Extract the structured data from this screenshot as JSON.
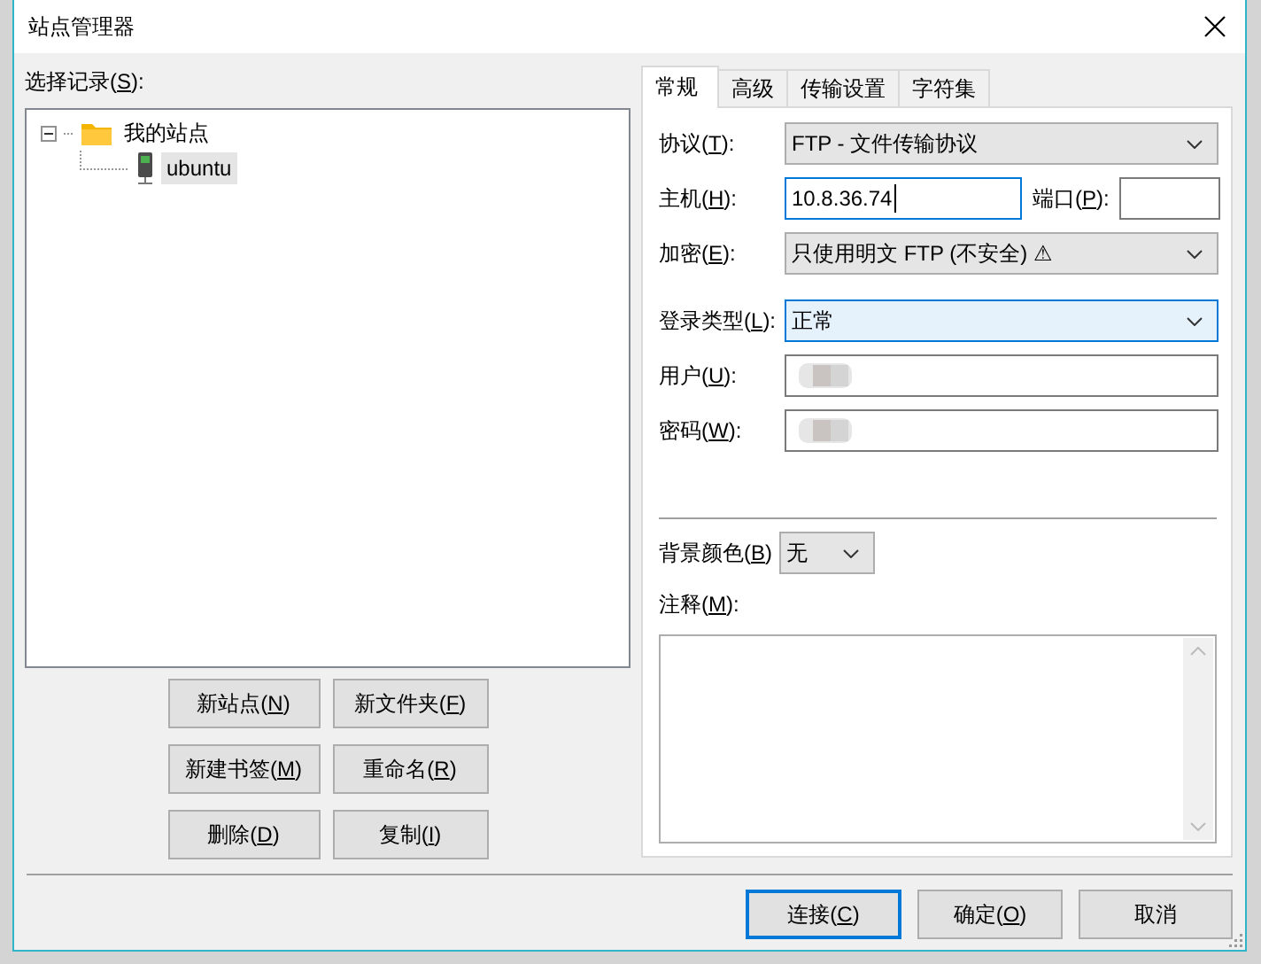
{
  "window": {
    "title": "站点管理器"
  },
  "site_list": {
    "label": [
      "选择记录(",
      "S",
      "):"
    ],
    "tree": [
      {
        "label": "我的站点",
        "kind": "folder",
        "expanded": true,
        "selected": false,
        "children": [
          {
            "label": "ubuntu",
            "kind": "server",
            "selected": true
          }
        ]
      }
    ]
  },
  "site_buttons": [
    {
      "label": [
        "新站点(",
        "N",
        ")"
      ]
    },
    {
      "label": [
        "新文件夹(",
        "F",
        ")"
      ]
    },
    {
      "label": [
        "新建书签(",
        "M",
        ")"
      ]
    },
    {
      "label": [
        "重命名(",
        "R",
        ")"
      ]
    },
    {
      "label": [
        "删除(",
        "D",
        ")"
      ]
    },
    {
      "label": [
        "复制(",
        "I",
        ")"
      ]
    }
  ],
  "tabs": [
    {
      "label": "常规",
      "selected": true
    },
    {
      "label": "高级",
      "selected": false
    },
    {
      "label": "传输设置",
      "selected": false
    },
    {
      "label": "字符集",
      "selected": false
    }
  ],
  "general": {
    "fields": [
      {
        "kind": "dropdown",
        "label": [
          "协议(",
          "T",
          "):"
        ],
        "value": "FTP - 文件传输协议",
        "focused": false
      },
      {
        "kind": "host",
        "label": [
          "主机(",
          "H",
          "):"
        ],
        "value": "10.8.36.74",
        "focused": true,
        "port_label": [
          "端口(",
          "P",
          "):"
        ]
      },
      {
        "kind": "dropdown",
        "label": [
          "加密(",
          "E",
          "):"
        ],
        "value": "只使用明文 FTP (不安全) ⚠",
        "focused": false
      },
      {
        "kind": "separator"
      },
      {
        "kind": "dropdown",
        "label": [
          "登录类型(",
          "L",
          "):"
        ],
        "value": "正常",
        "focused": true
      },
      {
        "kind": "text",
        "label": [
          "用户(",
          "U",
          "):"
        ],
        "redacted": true
      },
      {
        "kind": "text",
        "label": [
          "密码(",
          "W",
          "):"
        ],
        "redacted": true
      }
    ],
    "background_color": {
      "label": [
        "背景颜色(",
        "B",
        ")"
      ],
      "value": "无"
    },
    "comments": {
      "label": [
        "注释(",
        "M",
        "):"
      ]
    }
  },
  "buttons": [
    {
      "label": [
        "连接(",
        "C",
        ")"
      ],
      "default": true
    },
    {
      "label": [
        "确定(",
        "O",
        ")"
      ],
      "default": false
    },
    {
      "label": [
        "取消"
      ],
      "default": false
    }
  ]
}
